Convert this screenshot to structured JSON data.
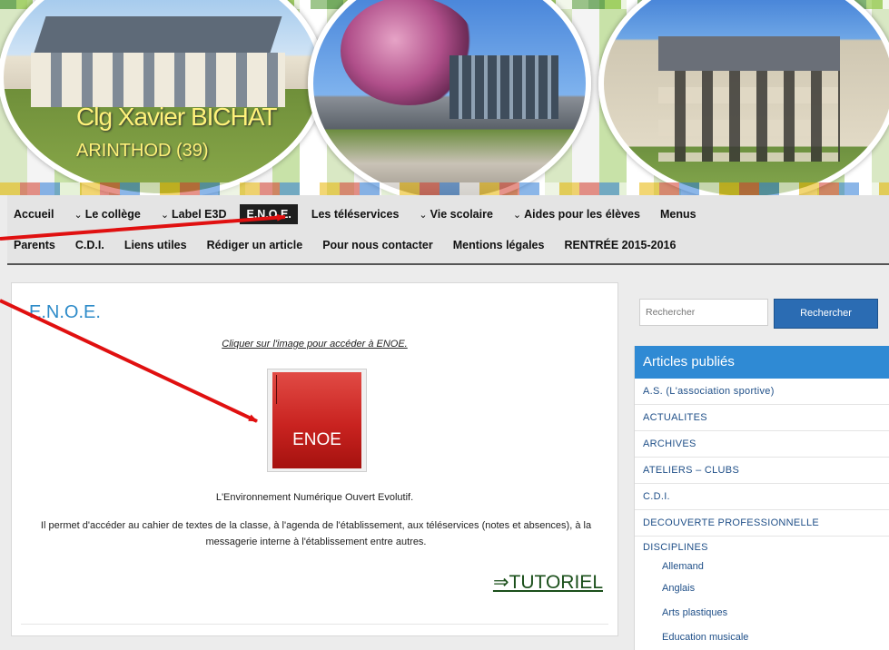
{
  "banner": {
    "school_name": "Clg Xavier BICHAT",
    "location": "ARINTHOD (39)"
  },
  "nav": {
    "row1": [
      {
        "label": "Accueil",
        "dropdown": false
      },
      {
        "label": "Le collège",
        "dropdown": true
      },
      {
        "label": "Label E3D",
        "dropdown": true
      },
      {
        "label": "E.N.O.E.",
        "dropdown": false,
        "active": true
      },
      {
        "label": "Les téléservices",
        "dropdown": false
      },
      {
        "label": "Vie scolaire",
        "dropdown": true
      },
      {
        "label": "Aides pour les élèves",
        "dropdown": true
      },
      {
        "label": "Menus",
        "dropdown": false
      }
    ],
    "row2": [
      {
        "label": "Parents"
      },
      {
        "label": "C.D.I."
      },
      {
        "label": "Liens utiles"
      },
      {
        "label": "Rédiger un article"
      },
      {
        "label": "Pour nous contacter"
      },
      {
        "label": "Mentions légales"
      },
      {
        "label": "RENTRÉE 2015-2016"
      }
    ],
    "chevron_glyph": "⌄"
  },
  "main": {
    "title": "E.N.O.E.",
    "caption": "Cliquer sur l'image pour accéder à ENOE.",
    "image_label": "ENOE",
    "description_1": "L'Environnement Numérique Ouvert Evolutif.",
    "description_2": "Il permet d'accéder au cahier de textes de la classe, à l'agenda de l'établissement, aux téléservices (notes et absences), à la messagerie interne à l'établissement entre autres.",
    "tutorial_link": "⇒TUTORIEL"
  },
  "sidebar": {
    "search_placeholder": "Rechercher",
    "search_button": "Rechercher",
    "widget_title": "Articles publiés",
    "categories": [
      "A.S. (L'association sportive)",
      "ACTUALITES",
      "ARCHIVES",
      "ATELIERS – CLUBS",
      "C.D.I.",
      "DECOUVERTE PROFESSIONNELLE",
      "DISCIPLINES"
    ],
    "subcategories": [
      "Allemand",
      "Anglais",
      "Arts plastiques",
      "Education musicale"
    ]
  },
  "colors": {
    "accent_blue": "#2f8ad4",
    "title_blue": "#2d8bc9",
    "annotation_red": "#e01010",
    "nav_active_bg": "#1e1e1e"
  }
}
